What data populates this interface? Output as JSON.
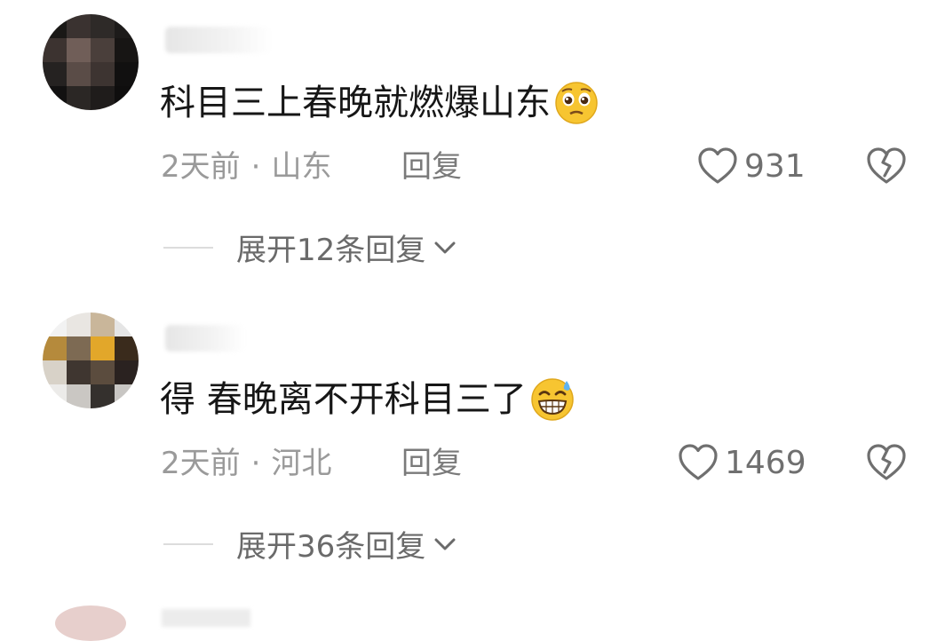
{
  "comments": [
    {
      "text": "科目三上春晚就燃爆山东",
      "emoji_icon": "pleading-face-icon",
      "time": "2天前",
      "separator": "·",
      "location": "山东",
      "reply_label": "回复",
      "likes": "931",
      "expand_label": "展开12条回复"
    },
    {
      "text": "得 春晚离不开科目三了",
      "emoji_icon": "grinning-sweat-face-icon",
      "time": "2天前",
      "separator": "·",
      "location": "河北",
      "reply_label": "回复",
      "likes": "1469",
      "expand_label": "展开36条回复"
    }
  ],
  "colors": {
    "text": "#161616",
    "meta": "#9a9a9a",
    "icon": "#6f6f6f",
    "emoji_yellow": "#f7c531"
  }
}
